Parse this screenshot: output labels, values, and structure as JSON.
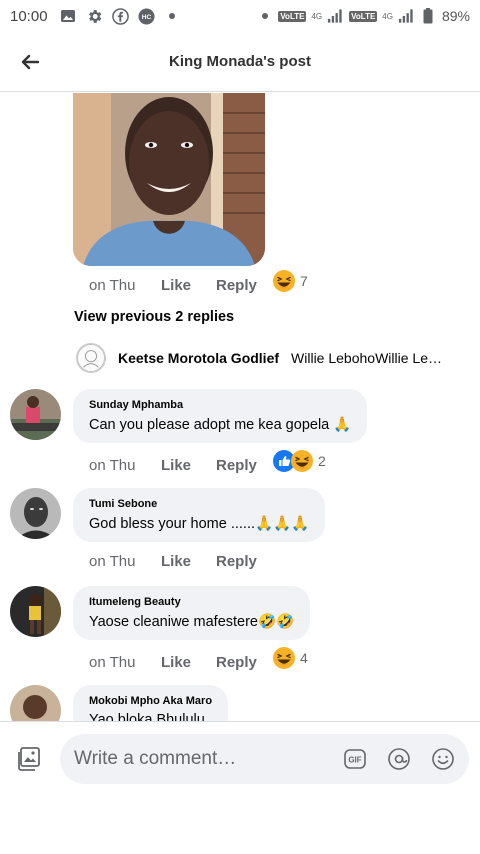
{
  "status_bar": {
    "time": "10:00",
    "battery": "89%",
    "volte_1": "VoLTE",
    "volte_2": "VoLTE",
    "network_1": "4G",
    "network_2": "4G"
  },
  "header": {
    "title": "King Monada's post"
  },
  "post_comment": {
    "time": "on Thu",
    "like_label": "Like",
    "reply_label": "Reply",
    "reaction_count": "7"
  },
  "view_previous": "View previous 2 replies",
  "reply_preview": {
    "name": "Keetse Morotola Godlief",
    "text": "Willie LebohoWillie Leboho"
  },
  "comments": [
    {
      "name": "Sunday Mphamba",
      "text": "Can you please adopt me kea gopela 🙏",
      "time": "on Thu",
      "like": "Like",
      "reply": "Reply",
      "reaction_count": "2"
    },
    {
      "name": "Tumi Sebone",
      "text": "God bless your  home ......🙏🙏🙏",
      "time": "on Thu",
      "like": "Like",
      "reply": "Reply"
    },
    {
      "name": "Itumeleng Beauty",
      "text": "Yaose cleaniwe mafestere🤣🤣",
      "time": "on Thu",
      "like": "Like",
      "reply": "Reply",
      "reaction_count": "4"
    },
    {
      "name": "Mokobi Mpho Aka Maro",
      "text": "Yao bloka Bhululu"
    }
  ],
  "composer": {
    "placeholder": "Write a comment…"
  },
  "colors": {
    "bubble": "#f0f2f5",
    "secondary_text": "#65676b",
    "like_blue": "#1877f2",
    "haha_yellow": "#f7b125"
  }
}
